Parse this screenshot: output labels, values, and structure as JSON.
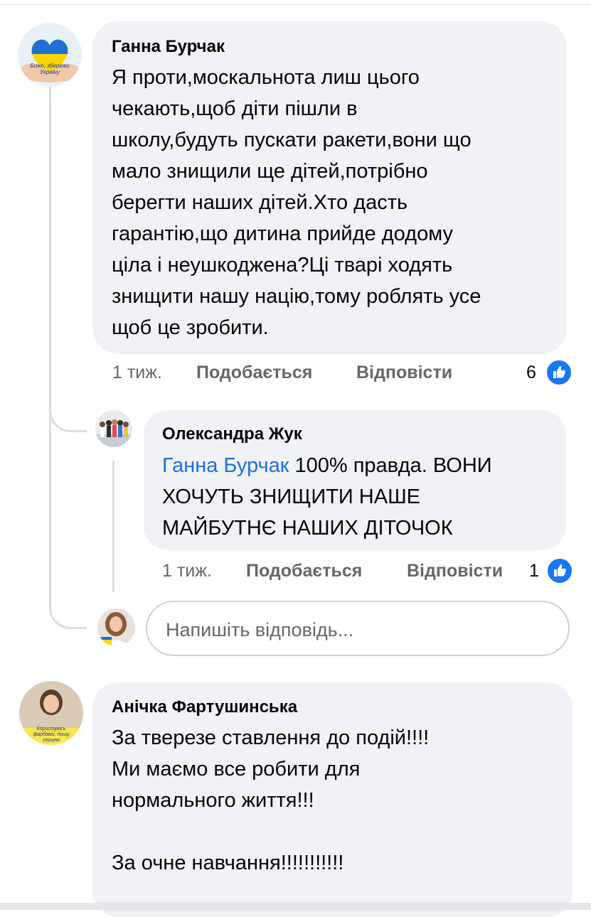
{
  "comments": [
    {
      "author": "Ганна Бурчак",
      "text": "Я проти,москальнота лиш цього\nчекають,щоб діти пішли в\nшколу,будуть пускати ракети,вони що\nмало знищили ще дітей,потрібно\nберегти наших дітей.Хто дасть\nгарантію,що дитина прийде додому\nціла і неушкоджена?Ці тварі ходять\nзнищити нашу націю,тому роблять усе\nщоб це зробити.",
      "avatar_caption": "Боже, збережи Україну",
      "time": "1 тиж.",
      "like_label": "Подобається",
      "reply_label": "Відповісти",
      "reactions": "6"
    },
    {
      "author": "Олександра Жук",
      "mention": "Ганна Бурчак",
      "text": "100% правда. ВОНИ\nХОЧУТЬ ЗНИЩИТИ НАШЕ\nМАЙБУТНЄ НАШИХ ДІТОЧОК",
      "time": "1 тиж.",
      "like_label": "Подобається",
      "reply_label": "Відповісти",
      "reactions": "1"
    },
    {
      "author": "Анічка Фартушинська",
      "text": "За тверезе ставлення до подій!!!!\nМи маємо все робити для\nнормального життя!!!\n\nЗа очне навчання!!!!!!!!!!!",
      "avatar_caption": "Користуюсь фарбами, пишу серцем"
    }
  ],
  "reply_input": {
    "placeholder": "Напишіть відповідь..."
  },
  "colors": {
    "bubble": "#f0f2f5",
    "like_blue": "#1877f2",
    "mention": "#216fdb",
    "meta": "#65676b"
  }
}
